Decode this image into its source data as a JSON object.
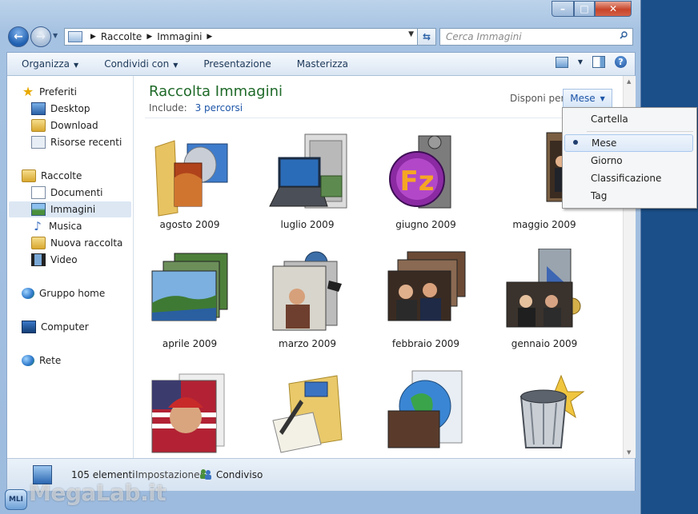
{
  "window": {
    "minimize_glyph": "–",
    "maximize_glyph": "□",
    "close_glyph": "✕"
  },
  "address": {
    "crumbs": [
      "Raccolte",
      "Immagini"
    ]
  },
  "search": {
    "placeholder": "Cerca Immagini"
  },
  "toolbar": {
    "organize": "Organizza",
    "share": "Condividi con",
    "slideshow": "Presentazione",
    "burn": "Masterizza",
    "help_glyph": "?"
  },
  "sidebar": {
    "favorites": "Preferiti",
    "desktop": "Desktop",
    "downloads": "Download",
    "recent": "Risorse recenti",
    "libraries": "Raccolte",
    "documents": "Documenti",
    "pictures": "Immagini",
    "music": "Musica",
    "new_library": "Nuova raccolta",
    "video": "Video",
    "homegroup": "Gruppo home",
    "computer": "Computer",
    "network": "Rete"
  },
  "library": {
    "title": "Raccolta Immagini",
    "include_label": "Include:",
    "include_link": "3 percorsi",
    "arrange_label": "Disponi per:",
    "arrange_value": "Mese"
  },
  "tiles": [
    "agosto 2009",
    "luglio 2009",
    "giugno 2009",
    "maggio 2009",
    "aprile 2009",
    "marzo 2009",
    "febbraio 2009",
    "gennaio 2009"
  ],
  "menu": {
    "items": [
      "Cartella",
      "Mese",
      "Giorno",
      "Classificazione",
      "Tag"
    ],
    "selected": "Mese"
  },
  "status": {
    "count": "105 elementi",
    "setting_label": "Impostazione:",
    "setting_value": "Condiviso"
  },
  "watermark": {
    "badge": "MLI",
    "text": "MegaLab.it"
  },
  "colors": {
    "title_green": "#1f6a29",
    "link_blue": "#1d55a8",
    "selection": "#dce7f3"
  }
}
